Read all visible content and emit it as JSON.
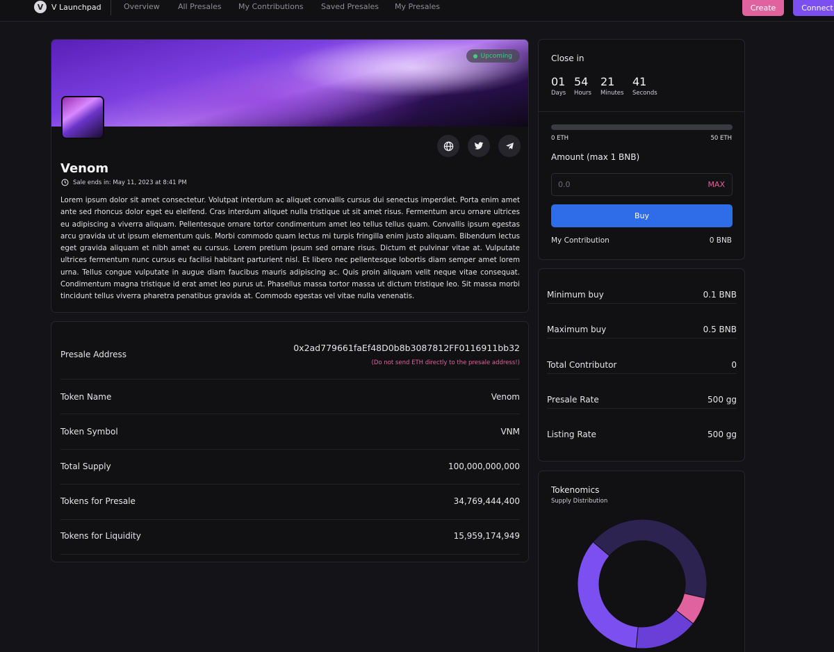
{
  "nav": {
    "brand": "V Launchpad",
    "brand_logo": "V",
    "links": [
      "Overview",
      "All Presales",
      "My Contributions",
      "Saved Presales",
      "My Presales"
    ],
    "create_label": "Create",
    "connect_label": "Connect"
  },
  "project": {
    "status": "Upcoming",
    "name": "Venom",
    "sale_ends": "Sale ends in: May 11, 2023 at 8:41 PM",
    "description": "Lorem ipsum dolor sit amet consectetur. Volutpat interdum ac aliquet convallis cursus dui senectus imperdiet. Porta enim amet ante sed rhoncus dolor eget eu eleifend. Cras interdum aliquet nulla tristique ut sit amet risus. Fermentum arcu ornare ultrices eu adipiscing a viverra aliquam. Pellentesque ornare tortor condimentum amet leo tellus tellus quam. Convallis ipsum egestas arcu gravida ut ut ipsum elementum quis. Morbi commodo quam lectus mi turpis fringilla enim justo aliquam. Bibendum lectus eget gravida aliquam et nibh amet eu cursus. Lorem pretium ipsum sed ornare risus. Dictum et pulvinar vitae at. Vulputate ultrices fermentum nunc cursus eu facilisi habitant parturient nisl. Et libero nec pellentesque lobortis diam semper amet lorem urna. Tellus congue vulputate in augue diam faucibus mauris adipiscing ac. Quis proin aliquam velit neque vitae consequat. Condimentum magna tristique id erat amet leo purus ut. Phasellus massa tortor massa ut dictum tristique leo. Sit massa morbi tincidunt tellus viverra pharetra penatibus gravida at. Commodo egestas vel vitae nulla venenatis.",
    "social_icons": [
      "globe-icon",
      "twitter-icon",
      "telegram-icon"
    ]
  },
  "info": {
    "presale_address_label": "Presale Address",
    "presale_address": "0x2ad779661faEf48D0b8b3087812FF0116911bb32",
    "presale_warning": "(Do not send ETH directly to the presale address!)",
    "rows": [
      {
        "label": "Token Name",
        "value": "Venom"
      },
      {
        "label": "Token Symbol",
        "value": "VNM"
      },
      {
        "label": "Total Supply",
        "value": "100,000,000,000"
      },
      {
        "label": "Tokens for Presale",
        "value": "34,769,444,400"
      },
      {
        "label": "Tokens for Liquidity",
        "value": "15,959,174,949"
      }
    ]
  },
  "buy": {
    "close_in_label": "Close in",
    "countdown": [
      {
        "value": "01",
        "unit": "Days"
      },
      {
        "value": "54",
        "unit": "Hours"
      },
      {
        "value": "21",
        "unit": "Minutes"
      },
      {
        "value": "41",
        "unit": "Seconds"
      }
    ],
    "progress_fraction": 0,
    "progress_min": "0 ETH",
    "progress_max": "50 ETH",
    "amount_label": "Amount (max 1 BNB)",
    "amount_placeholder": "0.0",
    "max_label": "MAX",
    "buy_label": "Buy",
    "contribution_label": "My Contribution",
    "contribution_value": "0 BNB"
  },
  "stats": [
    {
      "label": "Minimum buy",
      "value": "0.1 BNB"
    },
    {
      "label": "Maximum buy",
      "value": "0.5 BNB"
    },
    {
      "label": "Total Contributor",
      "value": "0"
    },
    {
      "label": "Presale Rate",
      "value": "500 gg"
    },
    {
      "label": "Listing Rate",
      "value": "500 gg"
    }
  ],
  "tokenomics": {
    "title": "Tokenomics",
    "subtitle": "Supply Distribution"
  },
  "chart_data": {
    "type": "pie",
    "style": "donut",
    "values": [
      34.77,
      15.96,
      7,
      42.27
    ],
    "colors": [
      "#7b4ff0",
      "#6a3fd8",
      "#e0629f",
      "#2c2350"
    ]
  },
  "colors": {
    "accent_pink": "#e0629f",
    "accent_purple": "#7b4ff0",
    "buy_blue": "#2f6de8",
    "status_green": "#3ed07a"
  }
}
